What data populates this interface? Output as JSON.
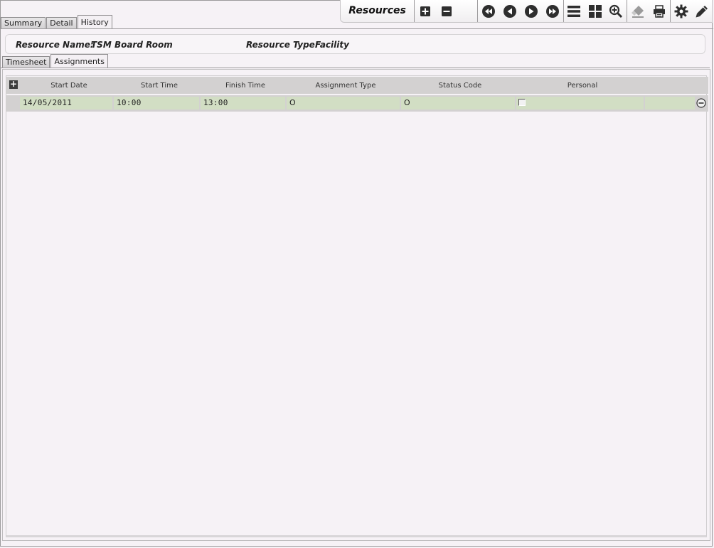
{
  "tabs": [
    "Summary",
    "Detail",
    "History"
  ],
  "toolbar": {
    "title": "Resources"
  },
  "resource": {
    "name_label": "Resource Name:",
    "name_value": "TSM Board Room",
    "type_label": "Resource Type:",
    "type_value": "Facility"
  },
  "sub_tabs": [
    "Timesheet",
    "Assignments"
  ],
  "grid": {
    "add_row_symbol": "+",
    "columns": [
      "Start Date",
      "Start Time",
      "Finish Time",
      "Assignment Type",
      "Status Code",
      "Personal"
    ],
    "rows": [
      {
        "start_date": "14/05/2011",
        "start_time": "10:00",
        "finish_time": "13:00",
        "assignment_type": "O",
        "status_code": "O",
        "personal": false
      }
    ]
  },
  "icons": [
    "add-record-icon",
    "delete-record-icon",
    "first-record-icon",
    "previous-record-icon",
    "next-record-icon",
    "last-record-icon",
    "list-view-icon",
    "grid-view-icon",
    "zoom-icon",
    "eraser-icon",
    "print-icon",
    "settings-icon",
    "edit-icon"
  ],
  "colors": {
    "row_cell": "#d2dec4",
    "header_bg": "#d3d1d1",
    "page_bg": "#f6f2f6"
  }
}
